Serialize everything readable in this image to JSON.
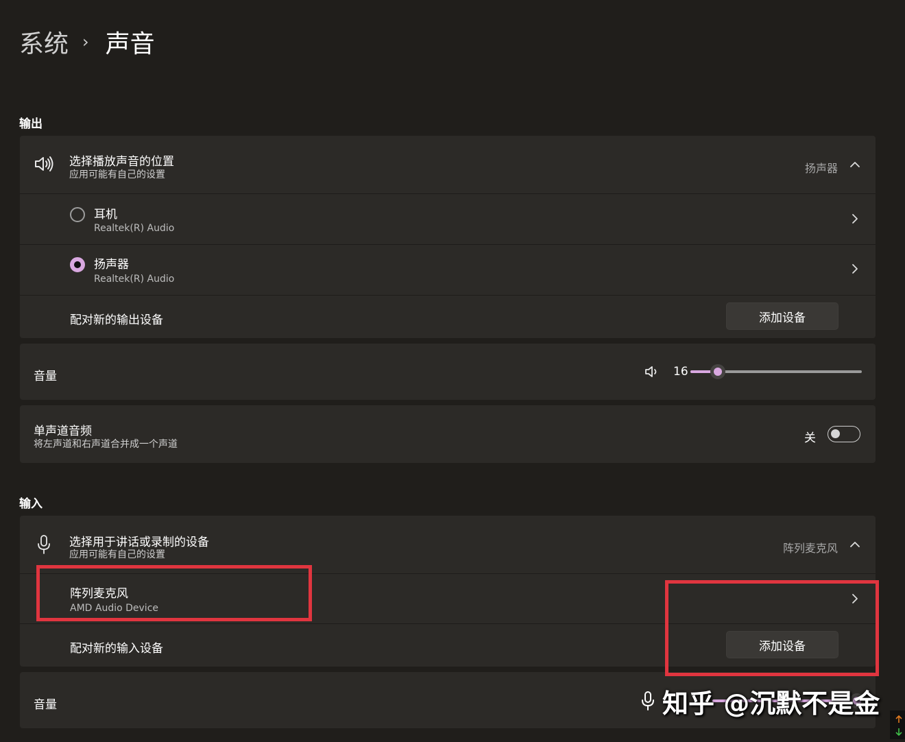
{
  "header": {
    "parent": "系统",
    "separator": "›",
    "current": "声音"
  },
  "output": {
    "section_title": "输出",
    "choose": {
      "title": "选择播放声音的位置",
      "subtitle": "应用可能有自己的设置",
      "selected_value": "扬声器"
    },
    "devices": [
      {
        "name": "耳机",
        "driver": "Realtek(R) Audio",
        "selected": false
      },
      {
        "name": "扬声器",
        "driver": "Realtek(R) Audio",
        "selected": true
      }
    ],
    "pair": {
      "label": "配对新的输出设备",
      "button": "添加设备"
    },
    "volume": {
      "label": "音量",
      "value": "16",
      "level": 0.16
    },
    "mono": {
      "title": "单声道音频",
      "subtitle": "将左声道和右声道合并成一个声道",
      "state": "关"
    }
  },
  "input": {
    "section_title": "输入",
    "choose": {
      "title": "选择用于讲话或录制的设备",
      "subtitle": "应用可能有自己的设置",
      "selected_value": "阵列麦克风"
    },
    "device": {
      "name": "阵列麦克风",
      "driver": "AMD Audio Device"
    },
    "pair": {
      "label": "配对新的输入设备",
      "button": "添加设备"
    },
    "volume": {
      "label": "音量"
    }
  },
  "watermark": {
    "text": "知乎 @沉默不是金"
  },
  "colors": {
    "accent": "#d9a8e0",
    "annotation": "#e0353f",
    "background": "#201e1b",
    "card": "#2c2a27"
  }
}
